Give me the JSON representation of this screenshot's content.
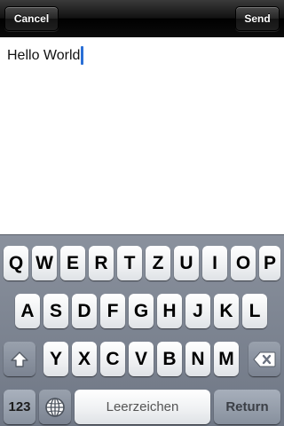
{
  "toolbar": {
    "cancel_label": "Cancel",
    "send_label": "Send"
  },
  "editor": {
    "text": "Hello World",
    "caret_color": "#2a6fd6"
  },
  "keyboard": {
    "row1": [
      "Q",
      "W",
      "E",
      "R",
      "T",
      "Z",
      "U",
      "I",
      "O",
      "P"
    ],
    "row2": [
      "A",
      "S",
      "D",
      "F",
      "G",
      "H",
      "J",
      "K",
      "L"
    ],
    "row3": [
      "Y",
      "X",
      "C",
      "V",
      "B",
      "N",
      "M"
    ],
    "shift_icon": "shift-arrow-icon",
    "delete_icon": "backspace-icon",
    "numbers_label": "123",
    "globe_icon": "globe-icon",
    "space_label": "Leerzeichen",
    "return_label": "Return"
  }
}
